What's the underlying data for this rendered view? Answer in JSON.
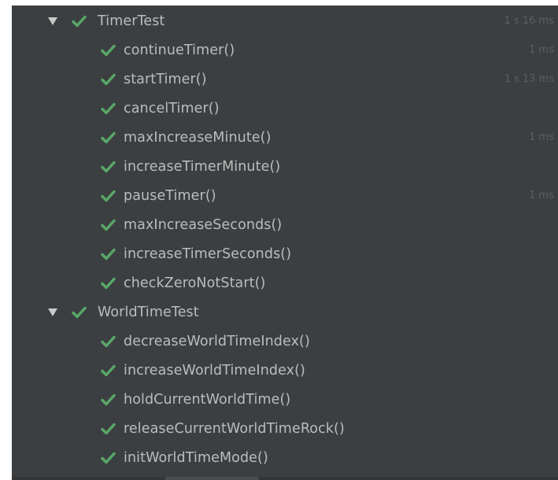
{
  "colors": {
    "panel_bg": "#3c3f41",
    "pass_green": "#59a869",
    "text": "#bcbcbc",
    "time_text": "#5b5f62",
    "arrow": "#c9c9c9"
  },
  "suites": [
    {
      "name": "TimerTest",
      "time": "1 s 16 ms",
      "status_icon": "check-icon",
      "tests": [
        {
          "name": "continueTimer()",
          "time": "1 ms"
        },
        {
          "name": "startTimer()",
          "time": "1 s 13 ms"
        },
        {
          "name": "cancelTimer()",
          "time": ""
        },
        {
          "name": "maxIncreaseMinute()",
          "time": "1 ms"
        },
        {
          "name": "increaseTimerMinute()",
          "time": ""
        },
        {
          "name": "pauseTimer()",
          "time": "1 ms"
        },
        {
          "name": "maxIncreaseSeconds()",
          "time": ""
        },
        {
          "name": "increaseTimerSeconds()",
          "time": ""
        },
        {
          "name": "checkZeroNotStart()",
          "time": ""
        }
      ]
    },
    {
      "name": "WorldTimeTest",
      "time": "",
      "status_icon": "check-icon",
      "tests": [
        {
          "name": "decreaseWorldTimeIndex()",
          "time": ""
        },
        {
          "name": "increaseWorldTimeIndex()",
          "time": ""
        },
        {
          "name": "holdCurrentWorldTime()",
          "time": ""
        },
        {
          "name": "releaseCurrentWorldTimeRock()",
          "time": ""
        },
        {
          "name": "initWorldTimeMode()",
          "time": ""
        }
      ]
    }
  ]
}
